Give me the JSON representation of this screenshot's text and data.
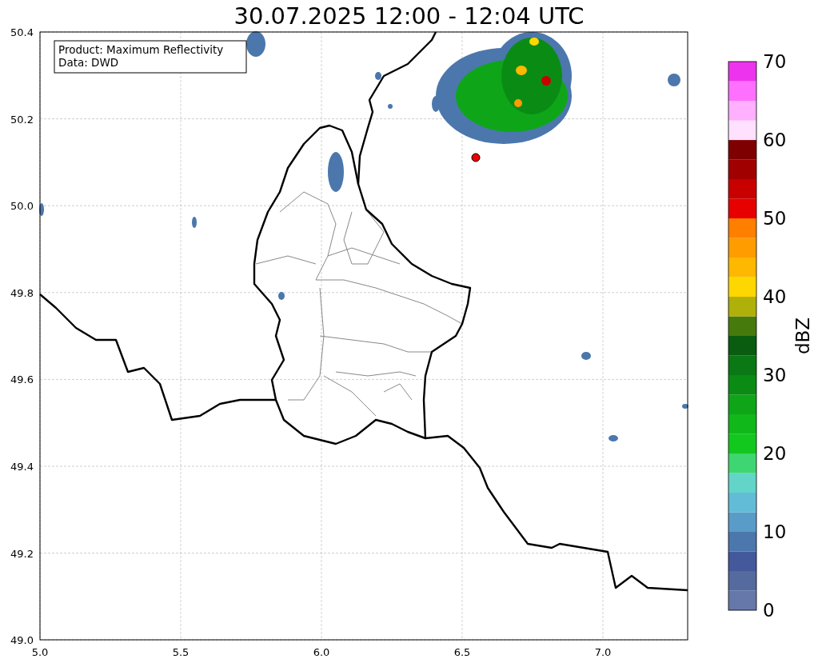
{
  "title": "30.07.2025 12:00 - 12:04 UTC",
  "annotation": [
    "Product: Maximum Reflectivity",
    "Data: DWD"
  ],
  "x_ticks": [
    "5.0",
    "5.5",
    "6.0",
    "6.5",
    "7.0"
  ],
  "y_ticks": [
    "50.4",
    "50.2",
    "50.0",
    "49.8",
    "49.6",
    "49.4",
    "49.2",
    "49.0"
  ],
  "colorbar": {
    "label": "dBZ",
    "ticks": [
      "70",
      "60",
      "50",
      "40",
      "30",
      "20",
      "10",
      "0"
    ]
  }
}
